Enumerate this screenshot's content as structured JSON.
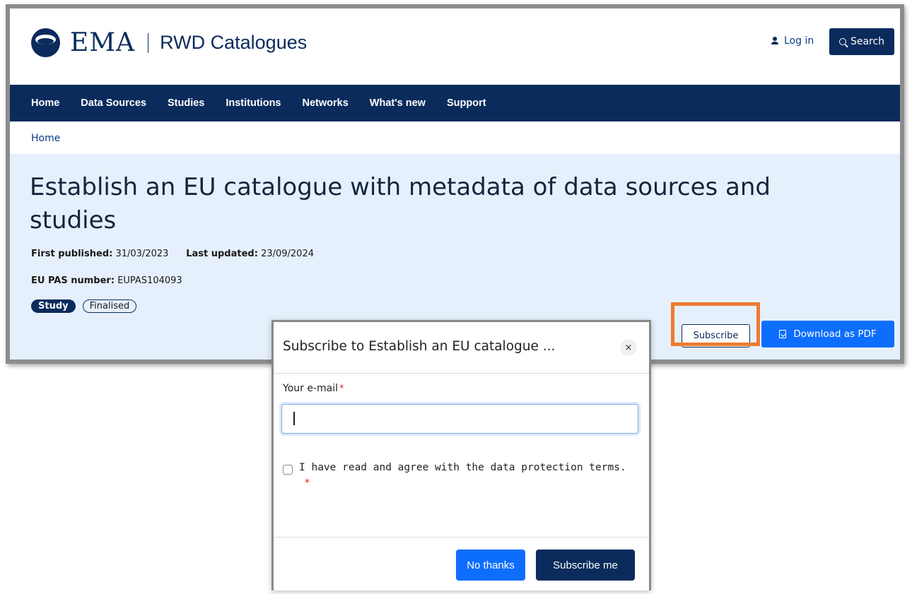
{
  "header": {
    "logo_text": "EMA",
    "site_name": "RWD Catalogues",
    "login_label": "Log in",
    "search_label": "Search"
  },
  "nav": {
    "items": [
      {
        "label": "Home"
      },
      {
        "label": "Data Sources"
      },
      {
        "label": "Studies"
      },
      {
        "label": "Institutions"
      },
      {
        "label": "Networks"
      },
      {
        "label": "What's new"
      },
      {
        "label": "Support"
      }
    ]
  },
  "breadcrumb": {
    "home": "Home"
  },
  "page": {
    "title": "Establish an EU catalogue with metadata of data sources and studies",
    "first_published_label": "First published:",
    "first_published_value": "31/03/2023",
    "last_updated_label": "Last updated:",
    "last_updated_value": "23/09/2024",
    "eu_pas_label": "EU PAS number:",
    "eu_pas_value": "EUPAS104093",
    "badge_type": "Study",
    "badge_status": "Finalised",
    "subscribe_label": "Subscribe",
    "pdf_label": "Download as PDF"
  },
  "modal": {
    "title": "Subscribe to Establish an EU catalogue ...",
    "close_label": "×",
    "email_label": "Your e-mail",
    "required_mark": "*",
    "email_value": "",
    "agree_text": "I have read and agree with the data protection terms.",
    "no_thanks_label": "No thanks",
    "subscribe_me_label": "Subscribe me"
  },
  "colors": {
    "brand_navy": "#0a2b5c",
    "primary_blue": "#0d6efd",
    "hero_bg": "#e6f0fc",
    "highlight_orange": "#ee7b30"
  }
}
